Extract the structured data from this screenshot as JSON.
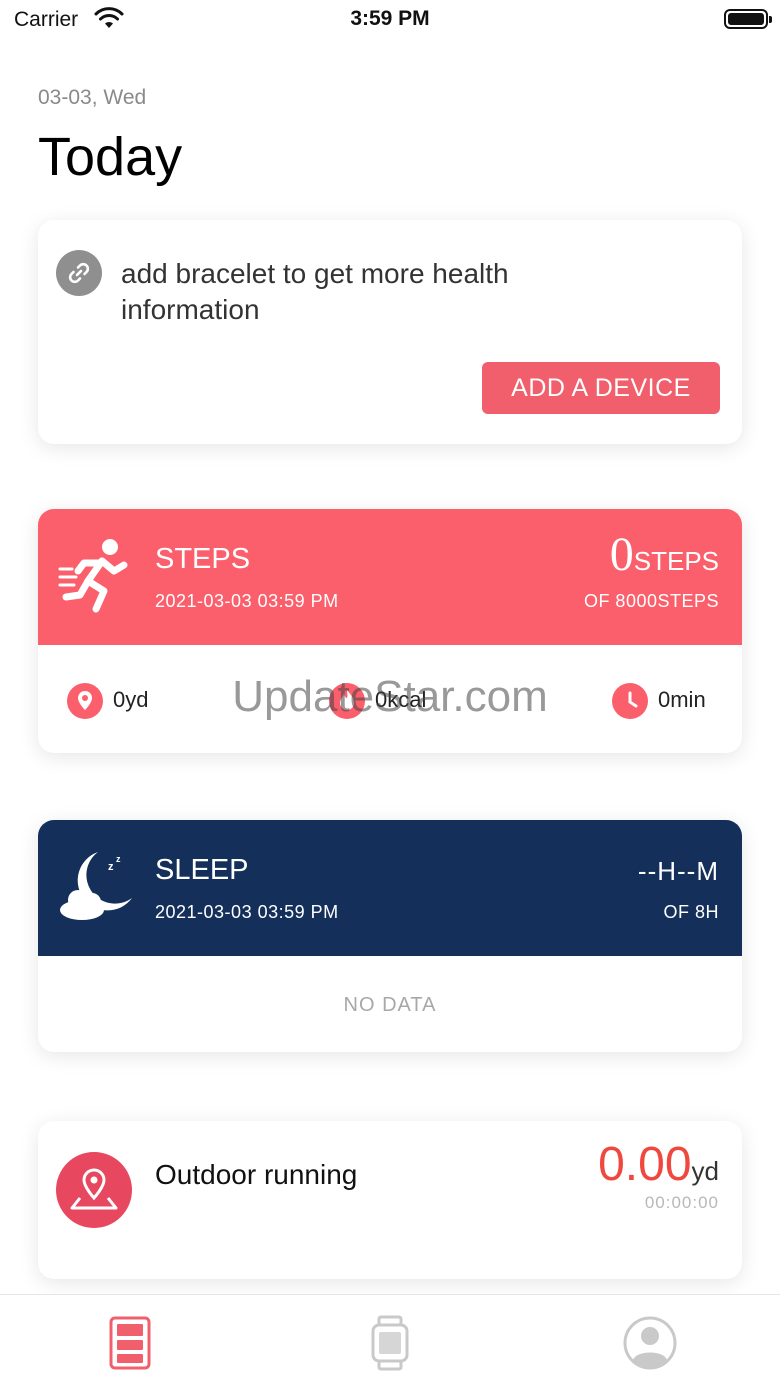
{
  "status_bar": {
    "carrier": "Carrier",
    "time": "3:59 PM"
  },
  "header": {
    "date": "03-03, Wed",
    "title": "Today"
  },
  "device_card": {
    "message": "add bracelet to get more health information",
    "button_label": "ADD A DEVICE"
  },
  "steps_card": {
    "title": "STEPS",
    "timestamp": "2021-03-03 03:59 PM",
    "value": "0",
    "unit": "STEPS",
    "goal": "OF 8000STEPS",
    "distance": "0yd",
    "calories": "0kcal",
    "duration": "0min",
    "accent": "#fb5f6c"
  },
  "sleep_card": {
    "title": "SLEEP",
    "timestamp": "2021-03-03 03:59 PM",
    "value": "--H--M",
    "goal": "OF 8H",
    "empty_text": "NO DATA",
    "accent": "#14305a"
  },
  "run_card": {
    "title": "Outdoor running",
    "distance": "0.00",
    "unit": "yd",
    "time": "00:00:00",
    "accent": "#f0473f"
  },
  "watermark": "UpdateStar.com",
  "tabs": [
    {
      "name": "home",
      "icon": "dashboard-icon",
      "active": true
    },
    {
      "name": "device",
      "icon": "watch-icon",
      "active": false
    },
    {
      "name": "profile",
      "icon": "user-icon",
      "active": false
    }
  ]
}
